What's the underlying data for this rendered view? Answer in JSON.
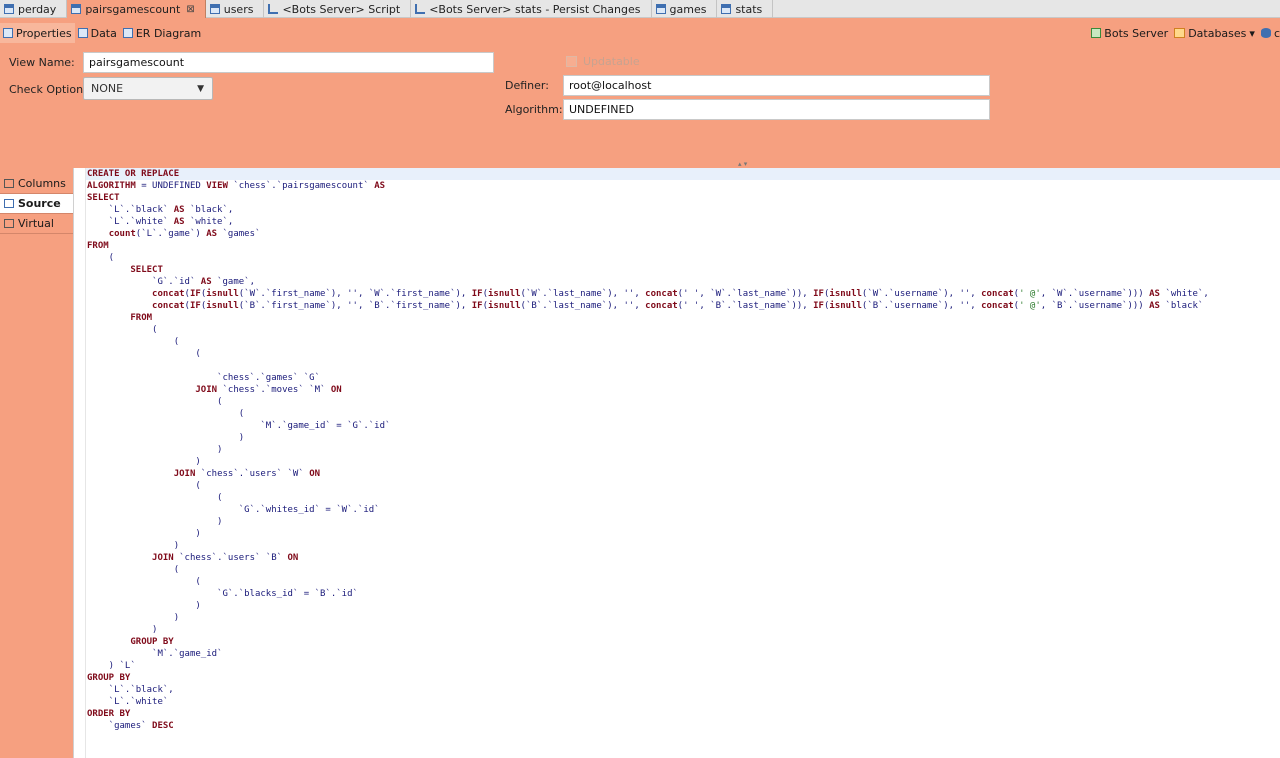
{
  "tabs": [
    {
      "label": "perday",
      "icon": "table-icon"
    },
    {
      "label": "pairsgamescount",
      "icon": "table-icon",
      "active": true,
      "closable": true
    },
    {
      "label": "users",
      "icon": "table-icon"
    },
    {
      "label": "<Bots Server> Script",
      "icon": "script-icon"
    },
    {
      "label": "<Bots Server> stats - Persist Changes",
      "icon": "script-icon"
    },
    {
      "label": "games",
      "icon": "table-icon"
    },
    {
      "label": "stats",
      "icon": "table-icon"
    }
  ],
  "editor_tabs": {
    "properties": "Properties",
    "data": "Data",
    "er_diagram": "ER Diagram"
  },
  "toolbar_right": {
    "server": "Bots Server",
    "databases": "Databases",
    "trailing": "c"
  },
  "form": {
    "view_name_label": "View Name:",
    "view_name_value": "pairsgamescount",
    "check_option_label": "Check Option:",
    "check_option_value": "NONE",
    "updatable_label": "Updatable",
    "definer_label": "Definer:",
    "definer_value": "root@localhost",
    "algorithm_label": "Algorithm:",
    "algorithm_value": "UNDEFINED"
  },
  "side_tabs": {
    "columns": "Columns",
    "source": "Source",
    "virtual": "Virtual"
  },
  "sql_lines": [
    [
      [
        "kw",
        "CREATE OR REPLACE"
      ]
    ],
    [
      [
        "kw",
        "ALGORITHM"
      ],
      [
        "t",
        " = UNDEFINED "
      ],
      [
        "kw",
        "VIEW"
      ],
      [
        "t",
        " `chess`.`pairsgamescount` "
      ],
      [
        "kw",
        "AS"
      ]
    ],
    [
      [
        "kw",
        "SELECT"
      ]
    ],
    [
      [
        "t",
        "    `L`.`black` "
      ],
      [
        "kw",
        "AS"
      ],
      [
        "t",
        " `black`,"
      ]
    ],
    [
      [
        "t",
        "    `L`.`white` "
      ],
      [
        "kw",
        "AS"
      ],
      [
        "t",
        " `white`,"
      ]
    ],
    [
      [
        "t",
        "    "
      ],
      [
        "kw",
        "count"
      ],
      [
        "t",
        "(`L`.`game`) "
      ],
      [
        "kw",
        "AS"
      ],
      [
        "t",
        " `games`"
      ]
    ],
    [
      [
        "kw",
        "FROM"
      ]
    ],
    [
      [
        "t",
        "    ("
      ]
    ],
    [
      [
        "t",
        "        "
      ],
      [
        "kw",
        "SELECT"
      ]
    ],
    [
      [
        "t",
        "            `G`.`id` "
      ],
      [
        "kw",
        "AS"
      ],
      [
        "t",
        " `game`,"
      ]
    ],
    [
      [
        "t",
        "            "
      ],
      [
        "kw",
        "concat"
      ],
      [
        "t",
        "("
      ],
      [
        "kw",
        "IF"
      ],
      [
        "t",
        "("
      ],
      [
        "kw",
        "isnull"
      ],
      [
        "t",
        "(`W`.`first_name`), '', `W`.`first_name`), "
      ],
      [
        "kw",
        "IF"
      ],
      [
        "t",
        "("
      ],
      [
        "kw",
        "isnull"
      ],
      [
        "t",
        "(`W`.`last_name`), '', "
      ],
      [
        "kw",
        "concat"
      ],
      [
        "t",
        "(' ', `W`.`last_name`)), "
      ],
      [
        "kw",
        "IF"
      ],
      [
        "t",
        "("
      ],
      [
        "kw",
        "isnull"
      ],
      [
        "t",
        "(`W`.`username`), '', "
      ],
      [
        "kw",
        "concat"
      ],
      [
        "t",
        "("
      ],
      [
        "str",
        "' @'"
      ],
      [
        "t",
        ", `W`.`username`))) "
      ],
      [
        "kw",
        "AS"
      ],
      [
        "t",
        " `white`,"
      ]
    ],
    [
      [
        "t",
        "            "
      ],
      [
        "kw",
        "concat"
      ],
      [
        "t",
        "("
      ],
      [
        "kw",
        "IF"
      ],
      [
        "t",
        "("
      ],
      [
        "kw",
        "isnull"
      ],
      [
        "t",
        "(`B`.`first_name`), '', `B`.`first_name`), "
      ],
      [
        "kw",
        "IF"
      ],
      [
        "t",
        "("
      ],
      [
        "kw",
        "isnull"
      ],
      [
        "t",
        "(`B`.`last_name`), '', "
      ],
      [
        "kw",
        "concat"
      ],
      [
        "t",
        "(' ', `B`.`last_name`)), "
      ],
      [
        "kw",
        "IF"
      ],
      [
        "t",
        "("
      ],
      [
        "kw",
        "isnull"
      ],
      [
        "t",
        "(`B`.`username`), '', "
      ],
      [
        "kw",
        "concat"
      ],
      [
        "t",
        "("
      ],
      [
        "str",
        "' @'"
      ],
      [
        "t",
        ", `B`.`username`))) "
      ],
      [
        "kw",
        "AS"
      ],
      [
        "t",
        " `black`"
      ]
    ],
    [
      [
        "t",
        "        "
      ],
      [
        "kw",
        "FROM"
      ]
    ],
    [
      [
        "t",
        "            ("
      ]
    ],
    [
      [
        "t",
        "                ("
      ]
    ],
    [
      [
        "t",
        "                    ("
      ]
    ],
    [
      [
        "t",
        ""
      ]
    ],
    [
      [
        "t",
        "                        `chess`.`games` `G`"
      ]
    ],
    [
      [
        "t",
        "                    "
      ],
      [
        "kw",
        "JOIN"
      ],
      [
        "t",
        " `chess`.`moves` `M` "
      ],
      [
        "kw",
        "ON"
      ]
    ],
    [
      [
        "t",
        "                        ("
      ]
    ],
    [
      [
        "t",
        "                            ("
      ]
    ],
    [
      [
        "t",
        "                                `M`.`game_id` = `G`.`id`"
      ]
    ],
    [
      [
        "t",
        "                            )"
      ]
    ],
    [
      [
        "t",
        "                        )"
      ]
    ],
    [
      [
        "t",
        "                    )"
      ]
    ],
    [
      [
        "t",
        "                "
      ],
      [
        "kw",
        "JOIN"
      ],
      [
        "t",
        " `chess`.`users` `W` "
      ],
      [
        "kw",
        "ON"
      ]
    ],
    [
      [
        "t",
        "                    ("
      ]
    ],
    [
      [
        "t",
        "                        ("
      ]
    ],
    [
      [
        "t",
        "                            `G`.`whites_id` = `W`.`id`"
      ]
    ],
    [
      [
        "t",
        "                        )"
      ]
    ],
    [
      [
        "t",
        "                    )"
      ]
    ],
    [
      [
        "t",
        "                )"
      ]
    ],
    [
      [
        "t",
        "            "
      ],
      [
        "kw",
        "JOIN"
      ],
      [
        "t",
        " `chess`.`users` `B` "
      ],
      [
        "kw",
        "ON"
      ]
    ],
    [
      [
        "t",
        "                ("
      ]
    ],
    [
      [
        "t",
        "                    ("
      ]
    ],
    [
      [
        "t",
        "                        `G`.`blacks_id` = `B`.`id`"
      ]
    ],
    [
      [
        "t",
        "                    )"
      ]
    ],
    [
      [
        "t",
        "                )"
      ]
    ],
    [
      [
        "t",
        "            )"
      ]
    ],
    [
      [
        "t",
        "        "
      ],
      [
        "kw",
        "GROUP BY"
      ]
    ],
    [
      [
        "t",
        "            `M`.`game_id`"
      ]
    ],
    [
      [
        "t",
        "    ) `L`"
      ]
    ],
    [
      [
        "kw",
        "GROUP BY"
      ]
    ],
    [
      [
        "t",
        "    `L`.`black`,"
      ]
    ],
    [
      [
        "t",
        "    `L`.`white`"
      ]
    ],
    [
      [
        "kw",
        "ORDER BY"
      ]
    ],
    [
      [
        "t",
        "    `games` "
      ],
      [
        "kw",
        "DESC"
      ]
    ]
  ]
}
